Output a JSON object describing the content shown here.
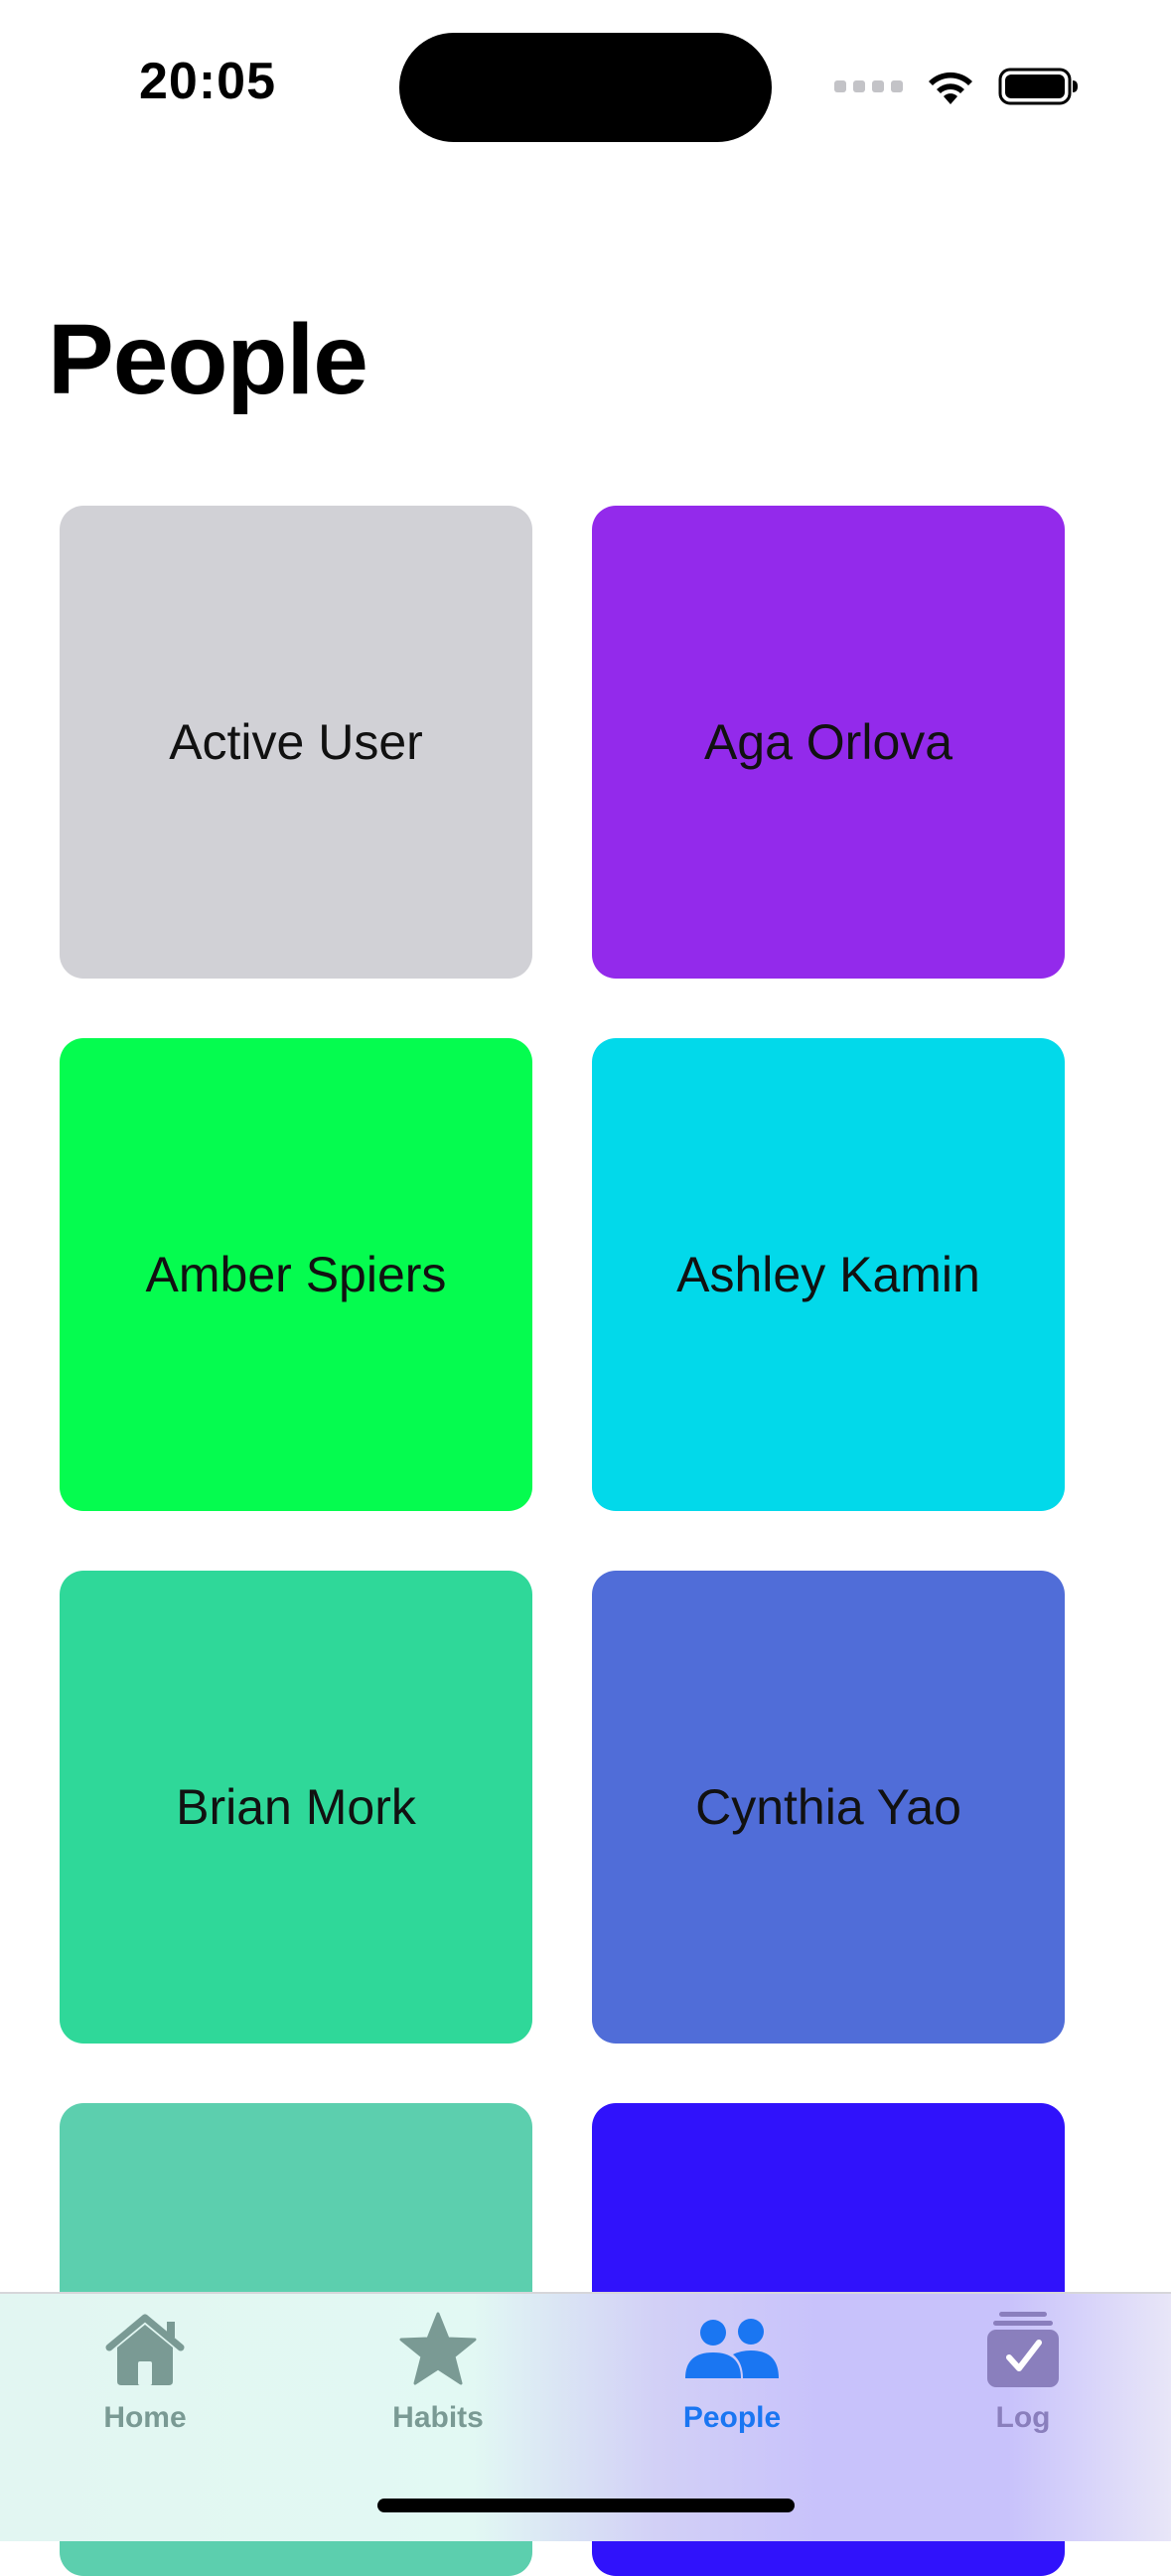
{
  "status_bar": {
    "time": "20:05"
  },
  "page": {
    "title": "People"
  },
  "people": [
    {
      "name": "Active User",
      "color": "#d1d1d6"
    },
    {
      "name": "Aga Orlova",
      "color": "#932aeb"
    },
    {
      "name": "Amber Spiers",
      "color": "#05fc4f"
    },
    {
      "name": "Ashley Kamin",
      "color": "#02d9ea"
    },
    {
      "name": "Brian Mork",
      "color": "#2fd899"
    },
    {
      "name": "Cynthia Yao",
      "color": "#506dd8"
    },
    {
      "name": "",
      "color": "#5ccfae"
    },
    {
      "name": "",
      "color": "#3012fb"
    }
  ],
  "tab_bar": {
    "tabs": [
      {
        "label": "Home",
        "icon": "house-icon",
        "color": "#7a9a94",
        "selected": false
      },
      {
        "label": "Habits",
        "icon": "star-icon",
        "color": "#7a9a94",
        "selected": false
      },
      {
        "label": "People",
        "icon": "people-icon",
        "color": "#1a76f2",
        "selected": true
      },
      {
        "label": "Log",
        "icon": "log-checkbox-icon",
        "color": "#8a7fbd",
        "selected": false
      }
    ]
  }
}
